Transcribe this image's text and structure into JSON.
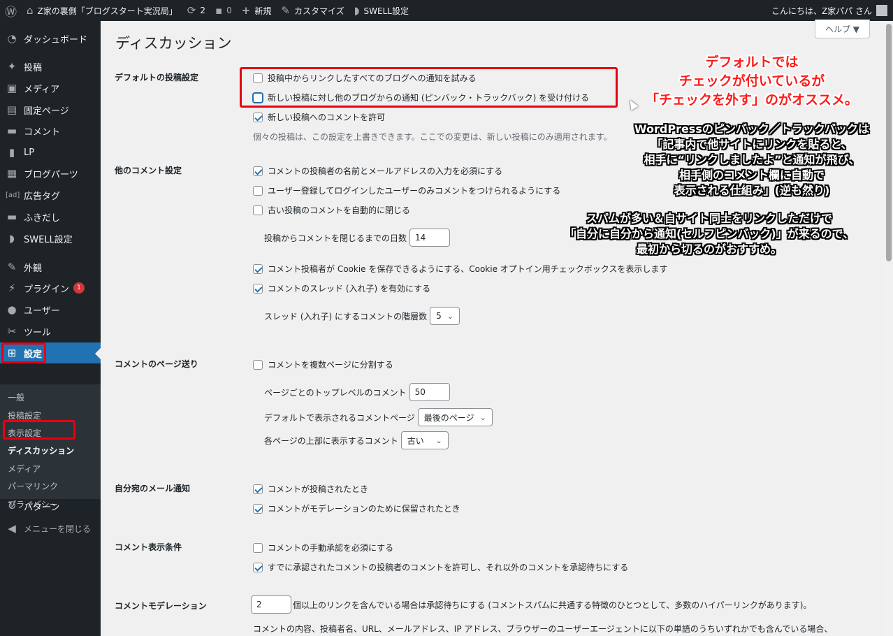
{
  "adminbar": {
    "site_name": "Z家の裏側「ブログスタート実況局」",
    "updates_count": "2",
    "comments_count": "0",
    "new_label": "新規",
    "customize_label": "カスタマイズ",
    "swell_label": "SWELL設定",
    "greeting": "こんにちは、Z家パパ さん"
  },
  "sidebar": {
    "items": [
      {
        "label": "ダッシュボード",
        "icon": "dashboard-icon"
      },
      {
        "label": "投稿",
        "icon": "pin-icon"
      },
      {
        "label": "メディア",
        "icon": "media-icon"
      },
      {
        "label": "固定ページ",
        "icon": "page-icon"
      },
      {
        "label": "コメント",
        "icon": "comment-icon"
      },
      {
        "label": "LP",
        "icon": "lp-icon"
      },
      {
        "label": "ブログパーツ",
        "icon": "blogparts-icon"
      },
      {
        "label": "広告タグ",
        "icon": "ad-icon"
      },
      {
        "label": "ふきだし",
        "icon": "balloon-icon"
      },
      {
        "label": "SWELL設定",
        "icon": "swell-icon"
      },
      {
        "label": "外観",
        "icon": "appearance-icon"
      },
      {
        "label": "プラグイン",
        "icon": "plugin-icon",
        "badge": "1"
      },
      {
        "label": "ユーザー",
        "icon": "user-icon"
      },
      {
        "label": "ツール",
        "icon": "tool-icon"
      },
      {
        "label": "設定",
        "icon": "settings-icon"
      },
      {
        "label": "パターン",
        "icon": "pattern-icon"
      },
      {
        "label": "メニューを閉じる",
        "icon": "collapse-icon"
      }
    ],
    "submenu": [
      "一般",
      "投稿設定",
      "表示設定",
      "ディスカッション",
      "メディア",
      "パーマリンク",
      "プライバシー"
    ]
  },
  "page": {
    "title": "ディスカッション",
    "help": "ヘルプ ▼"
  },
  "sections": {
    "default_post": {
      "label": "デフォルトの投稿設定",
      "opt1": "投稿中からリンクしたすべてのブログへの通知を試みる",
      "opt2": "新しい投稿に対し他のブログからの通知 (ピンバック・トラックバック) を受け付ける",
      "opt3": "新しい投稿へのコメントを許可",
      "desc": "個々の投稿は、この設定を上書きできます。ここでの変更は、新しい投稿にのみ適用されます。"
    },
    "other_comment": {
      "label": "他のコメント設定",
      "opt1": "コメントの投稿者の名前とメールアドレスの入力を必須にする",
      "opt2": "ユーザー登録してログインしたユーザーのみコメントをつけられるようにする",
      "opt3": "古い投稿のコメントを自動的に閉じる",
      "close_days_label": "投稿からコメントを閉じるまでの日数",
      "close_days_value": "14",
      "opt4": "コメント投稿者が Cookie を保存できるようにする、Cookie オプトイン用チェックボックスを表示します",
      "opt5": "コメントのスレッド (入れ子) を有効にする",
      "thread_depth_label": "スレッド (入れ子) にするコメントの階層数",
      "thread_depth_value": "5"
    },
    "paging": {
      "label": "コメントのページ送り",
      "opt1": "コメントを複数ページに分割する",
      "per_page_label": "ページごとのトップレベルのコメント",
      "per_page_value": "50",
      "default_page_label": "デフォルトで表示されるコメントページ",
      "default_page_value": "最後のページ",
      "order_label": "各ページの上部に表示するコメント",
      "order_value": "古い"
    },
    "email": {
      "label": "自分宛のメール通知",
      "opt1": "コメントが投稿されたとき",
      "opt2": "コメントがモデレーションのために保留されたとき"
    },
    "appear": {
      "label": "コメント表示条件",
      "opt1": "コメントの手動承認を必須にする",
      "opt2": "すでに承認されたコメントの投稿者のコメントを許可し、それ以外のコメントを承認待ちにする"
    },
    "moderation": {
      "label": "コメントモデレーション",
      "links_value": "2",
      "links_text": "個以上のリンクを含んでいる場合は承認待ちにする (コメントスパムに共通する特徴のひとつとして、多数のハイパーリンクがあります)。",
      "desc": "コメントの内容、投稿者名、URL、メールアドレス、IP アドレス、ブラウザーのユーザーエージェントに以下の単語のうちいずれかでも含んでいる場合、"
    }
  },
  "annotations": {
    "red_line1": "デフォルトでは",
    "red_line2": "チェックが付いているが",
    "red_line3": "「チェックを外す」のがオススメ。",
    "w1": "WordPressのピンバック／トラックバックは",
    "w2": "「記事内で他サイトにリンクを貼ると、",
    "w3": "相手に“リンクしましたよ”と通知が飛び、",
    "w4": "相手側のコメント欄に自動で",
    "w5": "表示される仕組み」(逆も然り)",
    "w6": "スパムが多い＆自サイト同士をリンクしただけで",
    "w7": "「自分に自分から通知(セルフピンバック)」が来るので、",
    "w8": "最初から切るのがおすすめ。"
  }
}
